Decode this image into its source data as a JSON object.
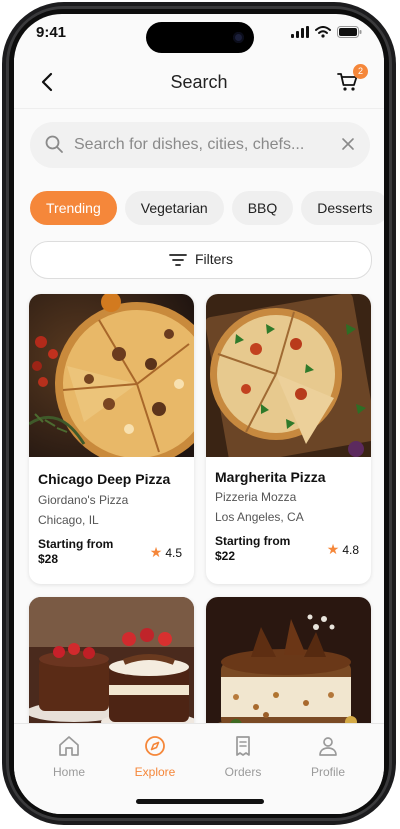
{
  "status": {
    "time": "9:41"
  },
  "header": {
    "title": "Search",
    "cart_count": "2"
  },
  "search": {
    "placeholder": "Search for dishes, cities, chefs..."
  },
  "chips": [
    "Trending",
    "Vegetarian",
    "BBQ",
    "Desserts"
  ],
  "filters": {
    "label": "Filters"
  },
  "cards": [
    {
      "name": "Chicago Deep Pizza",
      "restaurant": "Giordano's Pizza",
      "city": "Chicago, IL",
      "starting": "Starting from",
      "price": "$28",
      "rating": "4.5"
    },
    {
      "name": "Margherita Pizza",
      "restaurant": "Pizzeria Mozza",
      "city": "Los Angeles, CA",
      "starting": "Starting from",
      "price": "$22",
      "rating": "4.8"
    }
  ],
  "tabs": [
    {
      "label": "Home",
      "icon": "home-icon"
    },
    {
      "label": "Explore",
      "icon": "compass-icon"
    },
    {
      "label": "Orders",
      "icon": "receipt-icon"
    },
    {
      "label": "Profile",
      "icon": "user-icon"
    }
  ],
  "colors": {
    "accent": "#f5873a"
  }
}
